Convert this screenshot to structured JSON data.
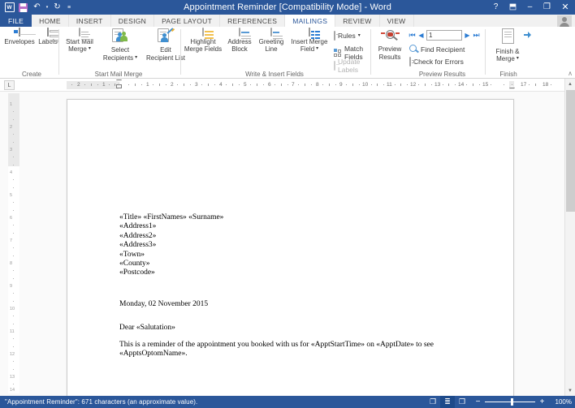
{
  "window": {
    "title": "Appointment Reminder [Compatibility Mode] - Word",
    "quick_access": [
      {
        "name": "word-logo-icon",
        "label": "W"
      },
      {
        "name": "save-icon",
        "label": ""
      },
      {
        "name": "undo-icon",
        "label": "↶"
      },
      {
        "name": "undo-caret-icon",
        "label": "▾"
      },
      {
        "name": "redo-icon",
        "label": "↻"
      },
      {
        "name": "customize-qat-icon",
        "label": "≡"
      }
    ],
    "controls": {
      "help": "?",
      "ribbon_display": "⬒",
      "minimize": "–",
      "restore": "❐",
      "close": "✕"
    }
  },
  "tabs": [
    {
      "label": "FILE",
      "active": false,
      "file": true
    },
    {
      "label": "HOME",
      "active": false
    },
    {
      "label": "INSERT",
      "active": false
    },
    {
      "label": "DESIGN",
      "active": false
    },
    {
      "label": "PAGE LAYOUT",
      "active": false
    },
    {
      "label": "REFERENCES",
      "active": false
    },
    {
      "label": "MAILINGS",
      "active": true
    },
    {
      "label": "REVIEW",
      "active": false
    },
    {
      "label": "VIEW",
      "active": false
    }
  ],
  "ribbon": {
    "groups": [
      {
        "name": "create",
        "label": "Create"
      },
      {
        "name": "start-mail-merge",
        "label": "Start Mail Merge"
      },
      {
        "name": "write-insert-fields",
        "label": "Write & Insert Fields"
      },
      {
        "name": "preview-results",
        "label": "Preview Results"
      },
      {
        "name": "finish",
        "label": "Finish"
      }
    ],
    "buttons": {
      "envelopes": "Envelopes",
      "labels": "Labels",
      "start_mail_merge": "Start Mail\nMerge",
      "start_mail_merge_l1": "Start Mail",
      "start_mail_merge_l2": "Merge",
      "select_recipients_l1": "Select",
      "select_recipients_l2": "Recipients",
      "edit_recipient_list_l1": "Edit",
      "edit_recipient_list_l2": "Recipient List",
      "highlight_merge_fields_l1": "Highlight",
      "highlight_merge_fields_l2": "Merge Fields",
      "address_block_l1": "Address",
      "address_block_l2": "Block",
      "greeting_line_l1": "Greeting",
      "greeting_line_l2": "Line",
      "insert_merge_field_l1": "Insert Merge",
      "insert_merge_field_l2": "Field",
      "rules": "Rules",
      "match_fields": "Match Fields",
      "update_labels": "Update Labels",
      "preview_results_l1": "Preview",
      "preview_results_l2": "Results",
      "find_recipient": "Find Recipient",
      "check_for_errors": "Check for Errors",
      "finish_merge_l1": "Finish &",
      "finish_merge_l2": "Merge",
      "caret": "▾",
      "collapse_ribbon": "∧"
    },
    "record_nav": {
      "first": "⏮",
      "prev": "◀",
      "value": "1",
      "next": "▶",
      "last": "⏭"
    }
  },
  "ruler": {
    "tab_stop_marker": "L",
    "h_labels": [
      "2",
      "1",
      "1",
      "2",
      "3",
      "4",
      "5",
      "6",
      "7",
      "8",
      "9",
      "10",
      "11",
      "12",
      "13",
      "14",
      "15",
      "17",
      "18"
    ],
    "v_labels": [
      "1",
      "2",
      "3",
      "4",
      "5",
      "6",
      "7",
      "8",
      "9",
      "10",
      "11",
      "12",
      "13",
      "14"
    ]
  },
  "document": {
    "address_lines": [
      "«Title» «FirstNames» «Surname»",
      "«Address1»",
      "«Address2»",
      "«Address3»",
      "«Town»",
      "«County»",
      "«Postcode»"
    ],
    "date_line": "Monday, 02 November 2015",
    "salutation": "Dear «Salutation»",
    "body_paragraph": "This is a reminder of the appointment you booked with us for «ApptStartTime» on «ApptDate» to see «ApptsOptomName»."
  },
  "status": {
    "message": "\"Appointment Reminder\": 671 characters (an approximate value).",
    "view_buttons": [
      {
        "name": "read-mode-icon",
        "glyph": "❐",
        "active": false
      },
      {
        "name": "print-layout-icon",
        "glyph": "≣",
        "active": true
      },
      {
        "name": "web-layout-icon",
        "glyph": "❒",
        "active": false
      }
    ],
    "zoom_out": "−",
    "zoom_in": "+",
    "zoom_level": "100%"
  },
  "colors": {
    "brand_blue": "#2b579a",
    "tab_active_text": "#2b579a",
    "ribbon_bg": "#ffffff",
    "canvas_bg": "#fafafa",
    "accent_icon_blue": "#2b7cd3"
  }
}
